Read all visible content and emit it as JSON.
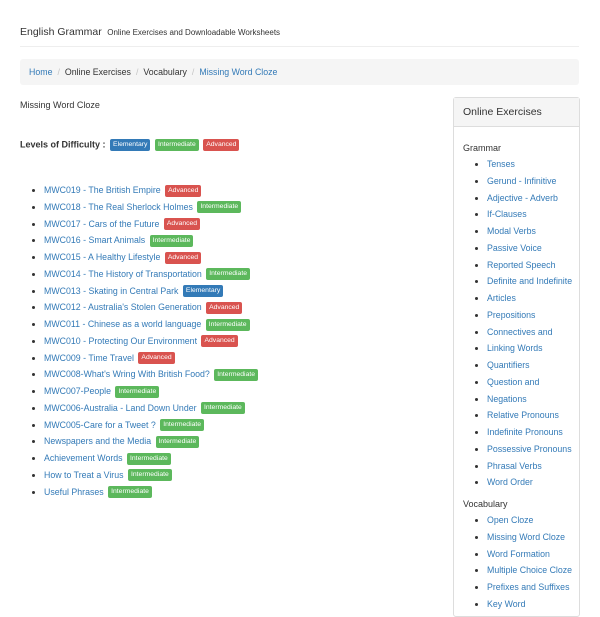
{
  "header": {
    "title": "English Grammar",
    "tagline": "Online Exercises and Downloadable Worksheets"
  },
  "breadcrumb": {
    "home": "Home",
    "online_exercises": "Online Exercises",
    "vocabulary": "Vocabulary",
    "current": "Missing Word Cloze",
    "separator": "/"
  },
  "page": {
    "title": "Missing Word Cloze",
    "levels_label": "Levels of Difficulty :",
    "levels": [
      "Elementary",
      "Intermediate",
      "Advanced"
    ]
  },
  "exercises": [
    {
      "label": "MWC019 - The British Empire",
      "level": "Advanced"
    },
    {
      "label": "MWC018 - The Real Sherlock Holmes",
      "level": "Intermediate"
    },
    {
      "label": "MWC017 - Cars of the Future",
      "level": "Advanced"
    },
    {
      "label": "MWC016 - Smart Animals",
      "level": "Intermediate"
    },
    {
      "label": "MWC015 - A Healthy Lifestyle",
      "level": "Advanced"
    },
    {
      "label": "MWC014 - The History of Transportation",
      "level": "Intermediate"
    },
    {
      "label": "MWC013 - Skating in Central Park",
      "level": "Elementary"
    },
    {
      "label": "MWC012 - Australia's Stolen Generation",
      "level": "Advanced"
    },
    {
      "label": "MWC011 - Chinese as a world language",
      "level": "Intermediate"
    },
    {
      "label": "MWC010 - Protecting Our Environment",
      "level": "Advanced"
    },
    {
      "label": "MWC009 - Time Travel",
      "level": "Advanced"
    },
    {
      "label": "MWC008-What's Wring With British Food?",
      "level": "Intermediate"
    },
    {
      "label": "MWC007-People",
      "level": "Intermediate"
    },
    {
      "label": "MWC006-Australia - Land Down Under",
      "level": "Intermediate"
    },
    {
      "label": "MWC005-Care for a Tweet ?",
      "level": "Intermediate"
    },
    {
      "label": "Newspapers and the Media",
      "level": "Intermediate"
    },
    {
      "label": "Achievement Words",
      "level": "Intermediate"
    },
    {
      "label": "How to Treat a Virus",
      "level": "Intermediate"
    },
    {
      "label": "Useful Phrases",
      "level": "Intermediate"
    }
  ],
  "sidebar": {
    "heading": "Online Exercises",
    "grammar_title": "Grammar",
    "grammar_lines": [
      "Tenses",
      "Gerund - Infinitive",
      "Adjective - Adverb",
      "If-Clauses",
      "Modal Verbs",
      "Passive Voice",
      "Reported Speech",
      "Definite and Indefinite",
      "Articles",
      "Prepositions",
      "Connectives and",
      "Linking Words",
      "Quantifiers",
      "Question and",
      "Negations",
      "Relative Pronouns",
      "Indefinite Pronouns",
      "Possessive Pronouns",
      "Phrasal Verbs",
      "Word Order"
    ],
    "vocabulary_title": "Vocabulary",
    "vocabulary_lines": [
      "Open Cloze",
      "Missing Word Cloze",
      "Word Formation",
      "Multiple Choice Cloze",
      "Prefixes and Suffixes",
      "Key Word"
    ]
  },
  "colors": {
    "link": "#337ab7",
    "elementary": "#337ab7",
    "intermediate": "#5cb85c",
    "advanced": "#d9534f"
  }
}
